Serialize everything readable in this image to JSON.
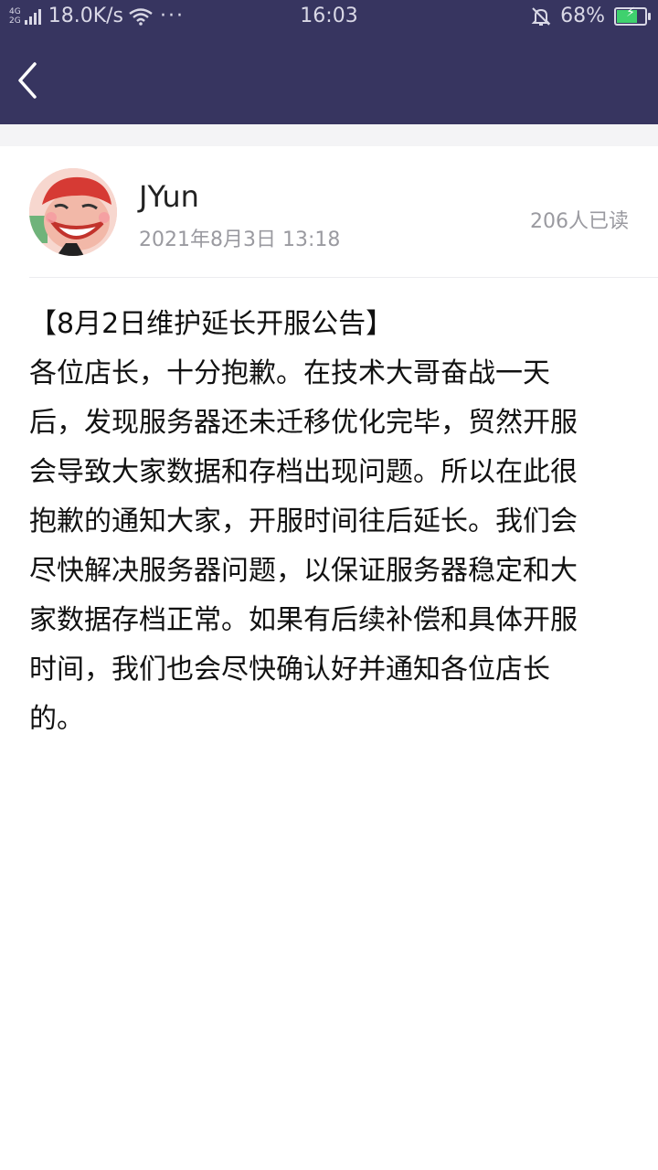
{
  "status_bar": {
    "network_type_top": "4G",
    "network_type_bottom": "2G",
    "speed": "18.0K/s",
    "more": "···",
    "time": "16:03",
    "battery_percent": "68%",
    "battery_level": 0.68,
    "icons": [
      "signal-icon",
      "wifi-icon",
      "bell-muted-icon",
      "battery-charging-icon"
    ]
  },
  "nav": {
    "back_icon": "chevron-left-icon"
  },
  "post": {
    "author": "JYun",
    "date": "2021年8月3日 13:18",
    "read_count": "206人已读",
    "content_lines": [
      "【8月2日维护延长开服公告】",
      "各位店长，十分抱歉。在技术大哥奋战一天",
      "后，发现服务器还未迁移优化完毕，贸然开服",
      "会导致大家数据和存档出现问题。所以在此很",
      "抱歉的通知大家，开服时间往后延长。我们会",
      "尽快解决服务器问题，以保证服务器稳定和大",
      "家数据存档正常。如果有后续补偿和具体开服",
      "时间，我们也会尽快确认好并通知各位店长",
      "的。"
    ]
  },
  "colors": {
    "header_bg": "#373560",
    "battery_green": "#3fd16e",
    "secondary_text": "#9a9aa0"
  }
}
